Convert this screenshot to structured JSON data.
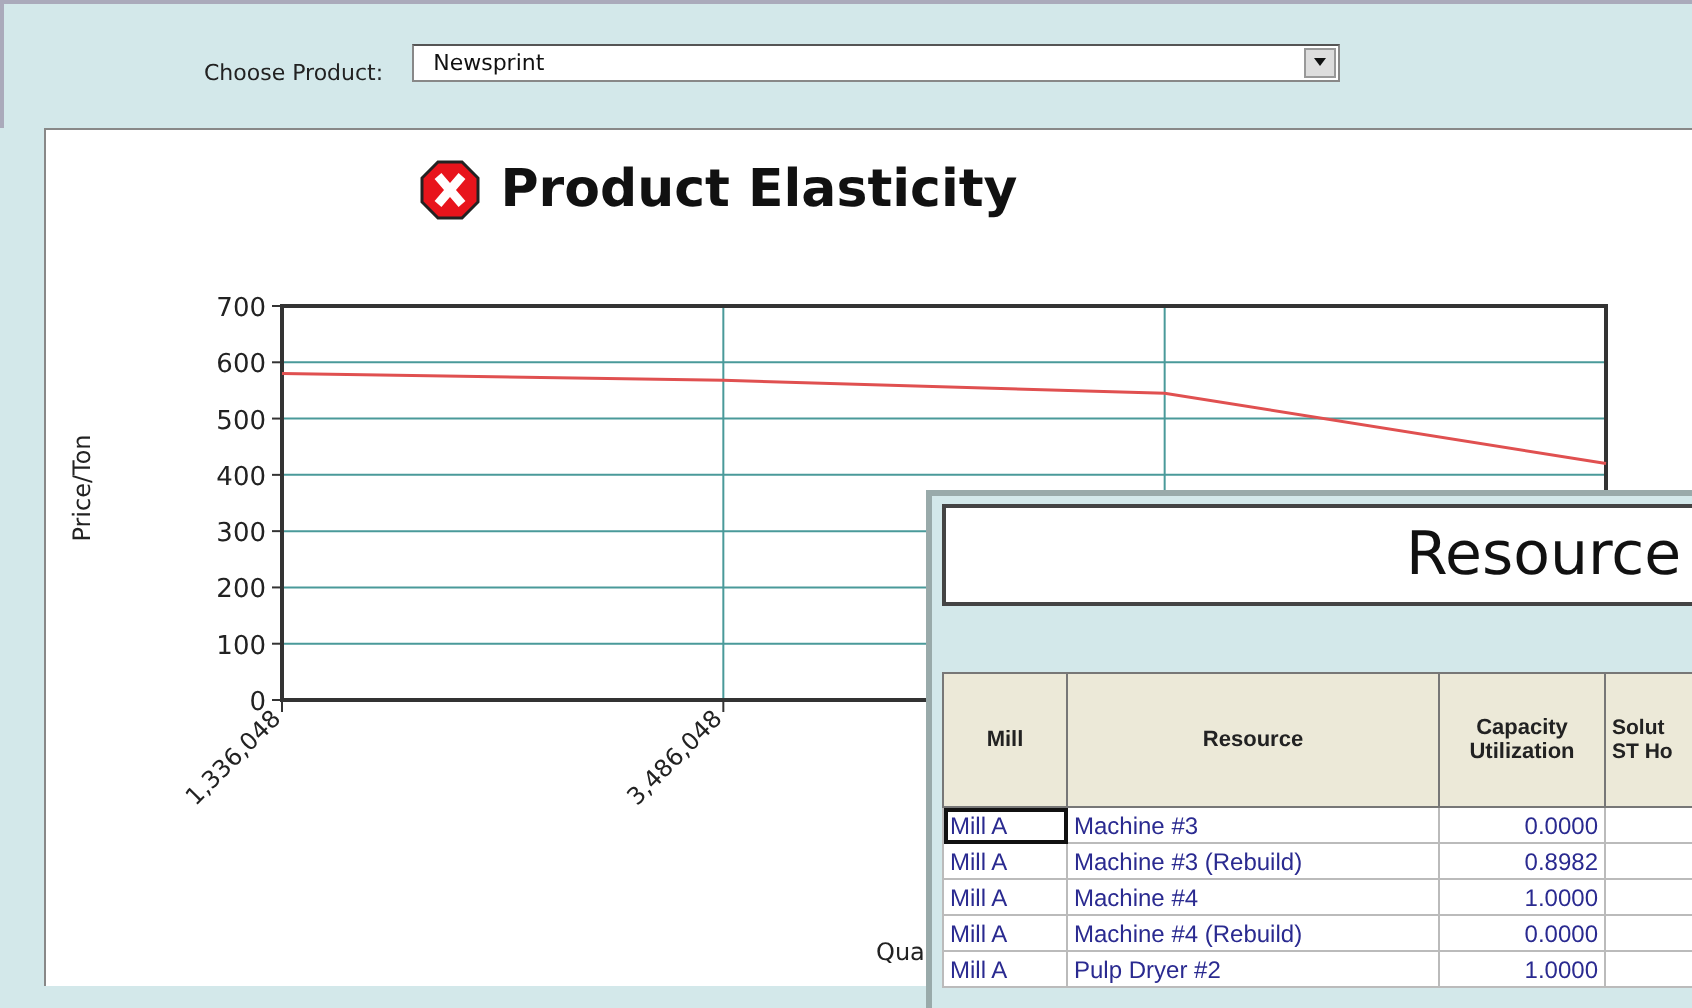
{
  "product_picker": {
    "label": "Choose Product:",
    "value": "Newsprint"
  },
  "chart_panel": {
    "title": "Product Elasticity",
    "chart_data": {
      "type": "line",
      "ylabel": "Price/Ton",
      "grid": true,
      "annotations": [
        {
          "text": "Qua"
        }
      ],
      "x": [
        1336048,
        3486048,
        5636048,
        7786048
      ],
      "series": [
        {
          "color": "#e05050",
          "values": [
            580,
            568,
            545,
            420
          ]
        }
      ],
      "xlim": [
        1336048,
        7786048
      ],
      "ylim": [
        0,
        700
      ],
      "xticks": [
        {
          "value": 1336048,
          "label": "1,336,048"
        },
        {
          "value": 3486048,
          "label": "3,486,048"
        }
      ],
      "yticks": [
        0,
        100,
        200,
        300,
        400,
        500,
        600,
        700
      ]
    }
  },
  "resource_window": {
    "title": "Resource",
    "columns": [
      "Mill",
      "Resource",
      "Capacity\nUtilization",
      "Solut\nST Ho"
    ],
    "rows": [
      {
        "mill": "Mill A",
        "resource": "Machine #3",
        "capacity_utilization": "0.0000",
        "selected": true
      },
      {
        "mill": "Mill A",
        "resource": "Machine #3 (Rebuild)",
        "capacity_utilization": "0.8982",
        "selected": false
      },
      {
        "mill": "Mill A",
        "resource": "Machine #4",
        "capacity_utilization": "1.0000",
        "selected": false
      },
      {
        "mill": "Mill A",
        "resource": "Machine #4 (Rebuild)",
        "capacity_utilization": "0.0000",
        "selected": false
      },
      {
        "mill": "Mill A",
        "resource": "Pulp Dryer #2",
        "capacity_utilization": "1.0000",
        "selected": false
      }
    ]
  }
}
